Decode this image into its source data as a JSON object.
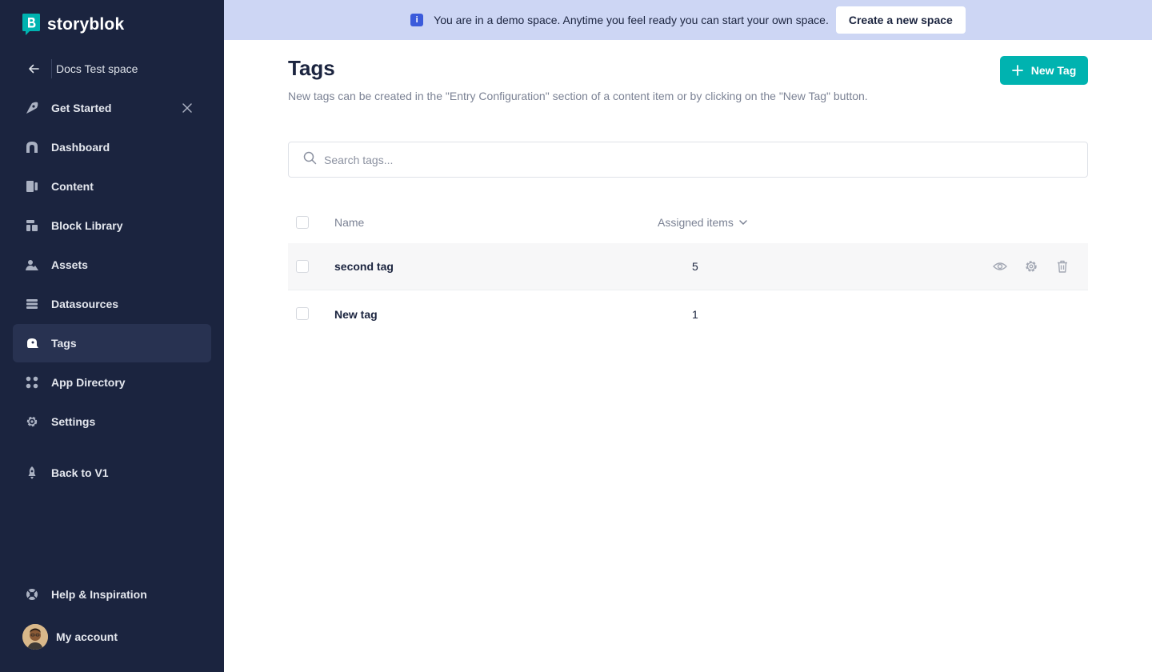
{
  "brand": {
    "name": "storyblok",
    "color": "#00b3b0"
  },
  "space": {
    "name": "Docs Test space"
  },
  "sidebar": {
    "items": [
      {
        "label": "Get Started",
        "icon": "rocket-icon",
        "closable": true
      },
      {
        "label": "Dashboard",
        "icon": "dashboard-icon"
      },
      {
        "label": "Content",
        "icon": "content-icon"
      },
      {
        "label": "Block Library",
        "icon": "block-library-icon"
      },
      {
        "label": "Assets",
        "icon": "assets-icon"
      },
      {
        "label": "Datasources",
        "icon": "datasources-icon"
      },
      {
        "label": "Tags",
        "icon": "tag-icon",
        "active": true
      },
      {
        "label": "App Directory",
        "icon": "app-directory-icon"
      },
      {
        "label": "Settings",
        "icon": "gear-icon"
      },
      {
        "label": "Back to V1",
        "icon": "back-v1-icon"
      }
    ],
    "help_label": "Help & Inspiration",
    "account_label": "My account"
  },
  "banner": {
    "text": "You are in a demo space. Anytime you feel ready you can start your own space.",
    "button_label": "Create a new space"
  },
  "page": {
    "title": "Tags",
    "subtitle": "New tags can be created in the \"Entry Configuration\" section of a content item or by clicking on the \"New Tag\" button.",
    "new_button_label": "New Tag"
  },
  "search": {
    "placeholder": "Search tags..."
  },
  "table": {
    "columns": {
      "name": "Name",
      "assigned": "Assigned items"
    },
    "rows": [
      {
        "name": "second tag",
        "count": "5"
      },
      {
        "name": "New tag",
        "count": "1"
      }
    ]
  }
}
